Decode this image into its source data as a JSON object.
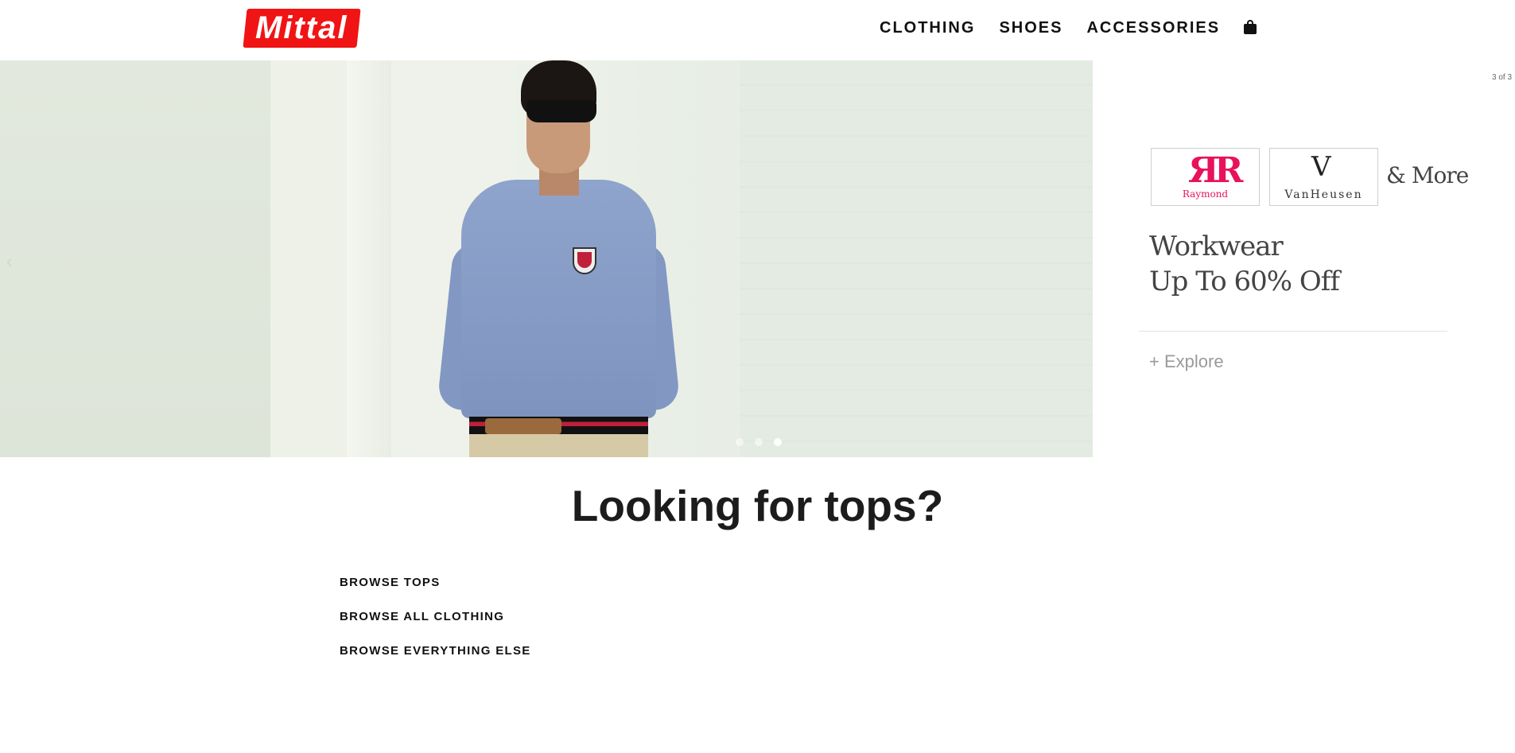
{
  "header": {
    "logo_text": "Mittal",
    "nav": [
      {
        "label": "CLOTHING"
      },
      {
        "label": "SHOES"
      },
      {
        "label": "ACCESSORIES"
      }
    ],
    "cart_icon": "shopping-bag-icon"
  },
  "hero": {
    "prev_arrow": "‹",
    "slides_total": 3,
    "active_slide": 3
  },
  "promo": {
    "counter": "3 of 3",
    "brands": [
      {
        "mark": "ЯR",
        "name": "Raymond"
      },
      {
        "mark": "V",
        "name": "VanHeusen"
      }
    ],
    "more": "& More",
    "line1": "Workwear",
    "line2": "Up To 60% Off",
    "explore": "+ Explore"
  },
  "main": {
    "headline": "Looking for tops?",
    "links": [
      {
        "label": "BROWSE TOPS"
      },
      {
        "label": "BROWSE ALL CLOTHING"
      },
      {
        "label": "BROWSE EVERYTHING ELSE"
      }
    ]
  },
  "colors": {
    "brand": "#f01414",
    "raymond": "#e8125c",
    "text": "#111111"
  }
}
